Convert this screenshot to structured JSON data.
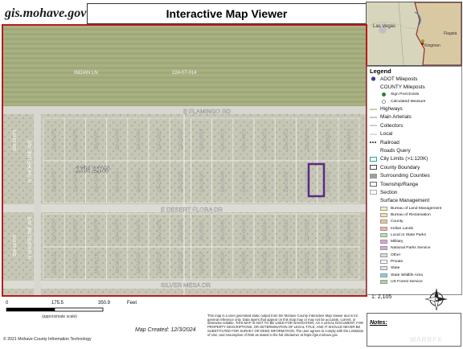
{
  "header": {
    "site": "gis.mohave.gov",
    "title": "Interactive Map Viewer"
  },
  "inset": {
    "labels": [
      "Las Vegas",
      "Kingman",
      "Flagsta"
    ]
  },
  "map": {
    "roads": {
      "flamingo": "E FLAMINGO RD",
      "desert_flora": "E DESERT FLORA DR",
      "silver_mesa": "SILVER MESA DR",
      "n_left": "N SHORELINE AVE",
      "indian": "INDIAN LN"
    },
    "township": "17N 21W",
    "big_parcel": "224-07-014",
    "parcels_row1_top": [
      "224-13-072",
      "224-13-070",
      "224-13-071",
      "224-13-006",
      "224-13-005",
      "224-13-007",
      "224-13-008",
      "224-13-009",
      "224-13-010",
      "224-13-011",
      "224-13-012",
      "224-13-013",
      "224-13-014",
      "224-13-015",
      "224-13-016"
    ],
    "parcels_row1_bottom": [
      "224-13-073",
      "224-13-047",
      "224-13-046",
      "224-13-045",
      "224-13-044",
      "224-13-043",
      "224-13-042",
      "224-13-041",
      "224-13-040",
      "224-13-039",
      "224-13-038",
      "224-13-037",
      "224-13-036",
      "224-13-035",
      "224-13-034"
    ],
    "parcels_row2_top": [
      "224-13-074",
      "224-13-075",
      "224-13-076",
      "224-13-077",
      "224-13-078",
      "224-13-079",
      "224-13-080",
      "224-13-081",
      "224-13-082",
      "224-13-083",
      "224-13-084",
      "224-13-085",
      "224-13-086",
      "224-13-087",
      "224-13-088"
    ],
    "parcels_row2_bottom": [
      "224-13-112",
      "224-13-111",
      "224-13-110",
      "224-13-109",
      "224-13-108",
      "224-13-107",
      "224-13-106",
      "224-13-105",
      "224-13-104",
      "224-13-103",
      "224-13-102",
      "224-13-101",
      "224-13-100",
      "224-13-099",
      "224-13-098"
    ]
  },
  "legend": {
    "title": "Legend",
    "items": [
      {
        "label": "ADOT Mileposts",
        "sub": false,
        "color": "#3a3a9a",
        "kind": "dot"
      },
      {
        "label": "COUNTY Mileposts",
        "sub": false,
        "color": "",
        "kind": "none"
      },
      {
        "label": "Sign Post Exists",
        "sub": true,
        "color": "#2e7d32",
        "kind": "dot"
      },
      {
        "label": "Calculated Measure",
        "sub": true,
        "color": "#888888",
        "kind": "ring"
      },
      {
        "label": "Highways",
        "sub": false,
        "color": "#7cb342",
        "kind": "line"
      },
      {
        "label": "Main Arterials",
        "sub": false,
        "color": "#8e8e8e",
        "kind": "line"
      },
      {
        "label": "Collectors",
        "sub": false,
        "color": "#9e9e9e",
        "kind": "line"
      },
      {
        "label": "Local",
        "sub": false,
        "color": "#bdbdbd",
        "kind": "line"
      },
      {
        "label": "Railroad",
        "sub": false,
        "color": "#555555",
        "kind": "dash"
      },
      {
        "label": "Roads Query",
        "sub": false,
        "color": "",
        "kind": "none"
      },
      {
        "label": "City Limits (>1:120K)",
        "sub": false,
        "color": "#26a69a",
        "kind": "box"
      },
      {
        "label": "County Boundary",
        "sub": false,
        "color": "#444444",
        "kind": "box"
      },
      {
        "label": "Surrounding Counties",
        "sub": false,
        "color": "#9e9e9e",
        "kind": "fill"
      },
      {
        "label": "Township/Range",
        "sub": false,
        "color": "#666666",
        "kind": "box"
      },
      {
        "label": "Section",
        "sub": false,
        "color": "#aaaaaa",
        "kind": "box"
      },
      {
        "label": "Surface Management",
        "sub": false,
        "color": "",
        "kind": "none"
      },
      {
        "label": "Bureau of Land Management",
        "sub": true,
        "color": "#fff3a6",
        "kind": "fill"
      },
      {
        "label": "Bureau of Reclamation",
        "sub": true,
        "color": "#f5e1a4",
        "kind": "fill"
      },
      {
        "label": "County",
        "sub": true,
        "color": "#f4c49a",
        "kind": "fill"
      },
      {
        "label": "Indian Lands",
        "sub": true,
        "color": "#f8b59b",
        "kind": "fill"
      },
      {
        "label": "Local or State Parks",
        "sub": true,
        "color": "#b9e3a0",
        "kind": "fill"
      },
      {
        "label": "Military",
        "sub": true,
        "color": "#e39fd9",
        "kind": "fill"
      },
      {
        "label": "National Parks Service",
        "sub": true,
        "color": "#d9a9d9",
        "kind": "fill"
      },
      {
        "label": "Other",
        "sub": true,
        "color": "#dcdcdc",
        "kind": "fill"
      },
      {
        "label": "Private",
        "sub": true,
        "color": "#ffffff",
        "kind": "fill"
      },
      {
        "label": "State",
        "sub": true,
        "color": "#cfe7ff",
        "kind": "fill"
      },
      {
        "label": "State Wildlife Area",
        "sub": true,
        "color": "#7fd6d6",
        "kind": "fill"
      },
      {
        "label": "US Forest Service",
        "sub": true,
        "color": "#a9d98e",
        "kind": "fill"
      }
    ]
  },
  "scale": {
    "ticks": [
      "0",
      "175.5",
      "350.9"
    ],
    "unit": "Feet",
    "note": "(approximate scale)"
  },
  "ratio": "1: 2,105",
  "disclaimer": "This map is a user generated static output from the Mohave County Interactive Map Viewer and is for general reference only. Data layers that appear on this map may or may not be accurate, current, or otherwise reliable. THIS MAP IS NOT TO BE USED FOR NAVIGATION, AS A LEGAL DOCUMENT, FOR PROPERTY DESCRIPTIONS, OR DETERMINATION OF LEGAL TITLE, AND IT SHOULD NEVER BE SUBSTITUTED FOR SURVEY OR DEED INFORMATION. The user agrees to comply with the Limitation of Use, and Assumption of Risk as stated in the full disclaimer at https://gis.mohave.gov",
  "created": "Map Created: 12/3/2024",
  "copyright": "© 2021 Mohave County Information Technology",
  "notes_label": "Notes:",
  "watermark": "WARRFX"
}
